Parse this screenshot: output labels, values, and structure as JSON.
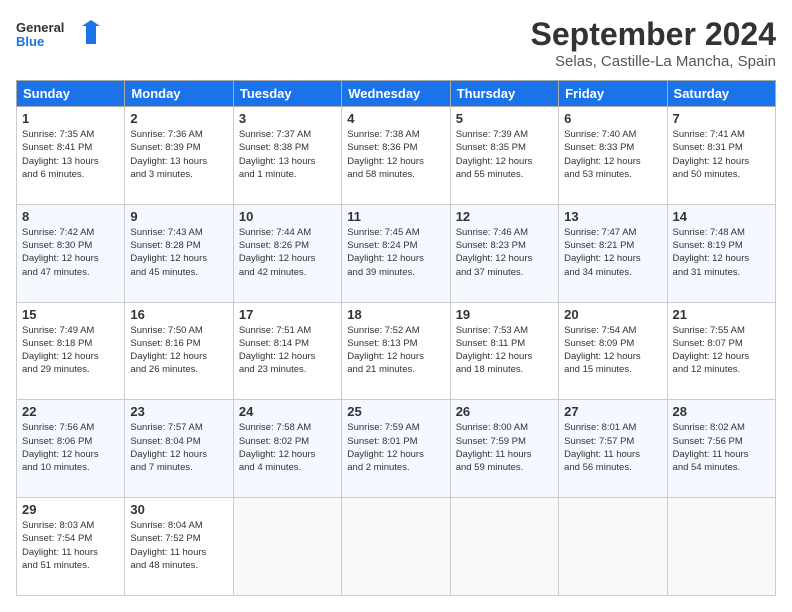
{
  "logo": {
    "line1": "General",
    "line2": "Blue"
  },
  "title": "September 2024",
  "subtitle": "Selas, Castille-La Mancha, Spain",
  "weekdays": [
    "Sunday",
    "Monday",
    "Tuesday",
    "Wednesday",
    "Thursday",
    "Friday",
    "Saturday"
  ],
  "weeks": [
    [
      {
        "day": "1",
        "info": "Sunrise: 7:35 AM\nSunset: 8:41 PM\nDaylight: 13 hours\nand 6 minutes."
      },
      {
        "day": "2",
        "info": "Sunrise: 7:36 AM\nSunset: 8:39 PM\nDaylight: 13 hours\nand 3 minutes."
      },
      {
        "day": "3",
        "info": "Sunrise: 7:37 AM\nSunset: 8:38 PM\nDaylight: 13 hours\nand 1 minute."
      },
      {
        "day": "4",
        "info": "Sunrise: 7:38 AM\nSunset: 8:36 PM\nDaylight: 12 hours\nand 58 minutes."
      },
      {
        "day": "5",
        "info": "Sunrise: 7:39 AM\nSunset: 8:35 PM\nDaylight: 12 hours\nand 55 minutes."
      },
      {
        "day": "6",
        "info": "Sunrise: 7:40 AM\nSunset: 8:33 PM\nDaylight: 12 hours\nand 53 minutes."
      },
      {
        "day": "7",
        "info": "Sunrise: 7:41 AM\nSunset: 8:31 PM\nDaylight: 12 hours\nand 50 minutes."
      }
    ],
    [
      {
        "day": "8",
        "info": "Sunrise: 7:42 AM\nSunset: 8:30 PM\nDaylight: 12 hours\nand 47 minutes."
      },
      {
        "day": "9",
        "info": "Sunrise: 7:43 AM\nSunset: 8:28 PM\nDaylight: 12 hours\nand 45 minutes."
      },
      {
        "day": "10",
        "info": "Sunrise: 7:44 AM\nSunset: 8:26 PM\nDaylight: 12 hours\nand 42 minutes."
      },
      {
        "day": "11",
        "info": "Sunrise: 7:45 AM\nSunset: 8:24 PM\nDaylight: 12 hours\nand 39 minutes."
      },
      {
        "day": "12",
        "info": "Sunrise: 7:46 AM\nSunset: 8:23 PM\nDaylight: 12 hours\nand 37 minutes."
      },
      {
        "day": "13",
        "info": "Sunrise: 7:47 AM\nSunset: 8:21 PM\nDaylight: 12 hours\nand 34 minutes."
      },
      {
        "day": "14",
        "info": "Sunrise: 7:48 AM\nSunset: 8:19 PM\nDaylight: 12 hours\nand 31 minutes."
      }
    ],
    [
      {
        "day": "15",
        "info": "Sunrise: 7:49 AM\nSunset: 8:18 PM\nDaylight: 12 hours\nand 29 minutes."
      },
      {
        "day": "16",
        "info": "Sunrise: 7:50 AM\nSunset: 8:16 PM\nDaylight: 12 hours\nand 26 minutes."
      },
      {
        "day": "17",
        "info": "Sunrise: 7:51 AM\nSunset: 8:14 PM\nDaylight: 12 hours\nand 23 minutes."
      },
      {
        "day": "18",
        "info": "Sunrise: 7:52 AM\nSunset: 8:13 PM\nDaylight: 12 hours\nand 21 minutes."
      },
      {
        "day": "19",
        "info": "Sunrise: 7:53 AM\nSunset: 8:11 PM\nDaylight: 12 hours\nand 18 minutes."
      },
      {
        "day": "20",
        "info": "Sunrise: 7:54 AM\nSunset: 8:09 PM\nDaylight: 12 hours\nand 15 minutes."
      },
      {
        "day": "21",
        "info": "Sunrise: 7:55 AM\nSunset: 8:07 PM\nDaylight: 12 hours\nand 12 minutes."
      }
    ],
    [
      {
        "day": "22",
        "info": "Sunrise: 7:56 AM\nSunset: 8:06 PM\nDaylight: 12 hours\nand 10 minutes."
      },
      {
        "day": "23",
        "info": "Sunrise: 7:57 AM\nSunset: 8:04 PM\nDaylight: 12 hours\nand 7 minutes."
      },
      {
        "day": "24",
        "info": "Sunrise: 7:58 AM\nSunset: 8:02 PM\nDaylight: 12 hours\nand 4 minutes."
      },
      {
        "day": "25",
        "info": "Sunrise: 7:59 AM\nSunset: 8:01 PM\nDaylight: 12 hours\nand 2 minutes."
      },
      {
        "day": "26",
        "info": "Sunrise: 8:00 AM\nSunset: 7:59 PM\nDaylight: 11 hours\nand 59 minutes."
      },
      {
        "day": "27",
        "info": "Sunrise: 8:01 AM\nSunset: 7:57 PM\nDaylight: 11 hours\nand 56 minutes."
      },
      {
        "day": "28",
        "info": "Sunrise: 8:02 AM\nSunset: 7:56 PM\nDaylight: 11 hours\nand 54 minutes."
      }
    ],
    [
      {
        "day": "29",
        "info": "Sunrise: 8:03 AM\nSunset: 7:54 PM\nDaylight: 11 hours\nand 51 minutes."
      },
      {
        "day": "30",
        "info": "Sunrise: 8:04 AM\nSunset: 7:52 PM\nDaylight: 11 hours\nand 48 minutes."
      },
      null,
      null,
      null,
      null,
      null
    ]
  ]
}
